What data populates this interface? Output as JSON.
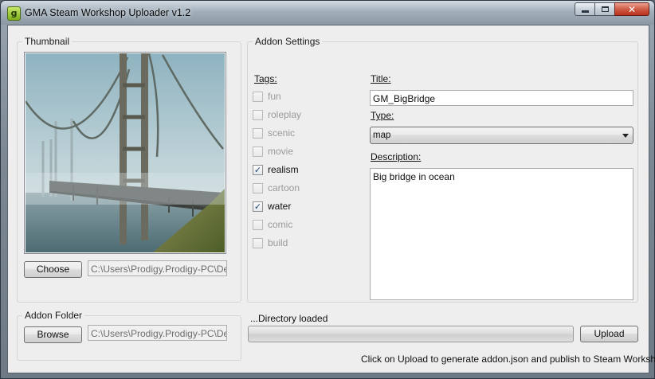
{
  "window": {
    "title": "GMA Steam Workshop Uploader v1.2",
    "icon_letter": "g",
    "close_glyph": "✕"
  },
  "thumbnail": {
    "group_label": "Thumbnail",
    "choose_label": "Choose",
    "path": "C:\\Users\\Prodigy.Prodigy-PC\\Desktop"
  },
  "addon_folder": {
    "group_label": "Addon Folder",
    "browse_label": "Browse",
    "path": "C:\\Users\\Prodigy.Prodigy-PC\\Desktop"
  },
  "settings": {
    "group_label": "Addon Settings",
    "tags_label": "Tags:",
    "tags": [
      {
        "label": "fun",
        "checked": false
      },
      {
        "label": "roleplay",
        "checked": false
      },
      {
        "label": "scenic",
        "checked": false
      },
      {
        "label": "movie",
        "checked": false
      },
      {
        "label": "realism",
        "checked": true
      },
      {
        "label": "cartoon",
        "checked": false
      },
      {
        "label": "water",
        "checked": true
      },
      {
        "label": "comic",
        "checked": false
      },
      {
        "label": "build",
        "checked": false
      }
    ],
    "title_label": "Title:",
    "title_value": "GM_BigBridge",
    "type_label": "Type:",
    "type_value": "map",
    "description_label": "Description:",
    "description_value": "Big bridge in ocean"
  },
  "status": {
    "text": "...Directory loaded",
    "progress_fraction": 0,
    "upload_label": "Upload",
    "hint": "Click on Upload to generate addon.json and publish to Steam Workshop."
  },
  "colors": {
    "check_mark": "#23466f",
    "disabled_text": "#9a9a9a"
  }
}
